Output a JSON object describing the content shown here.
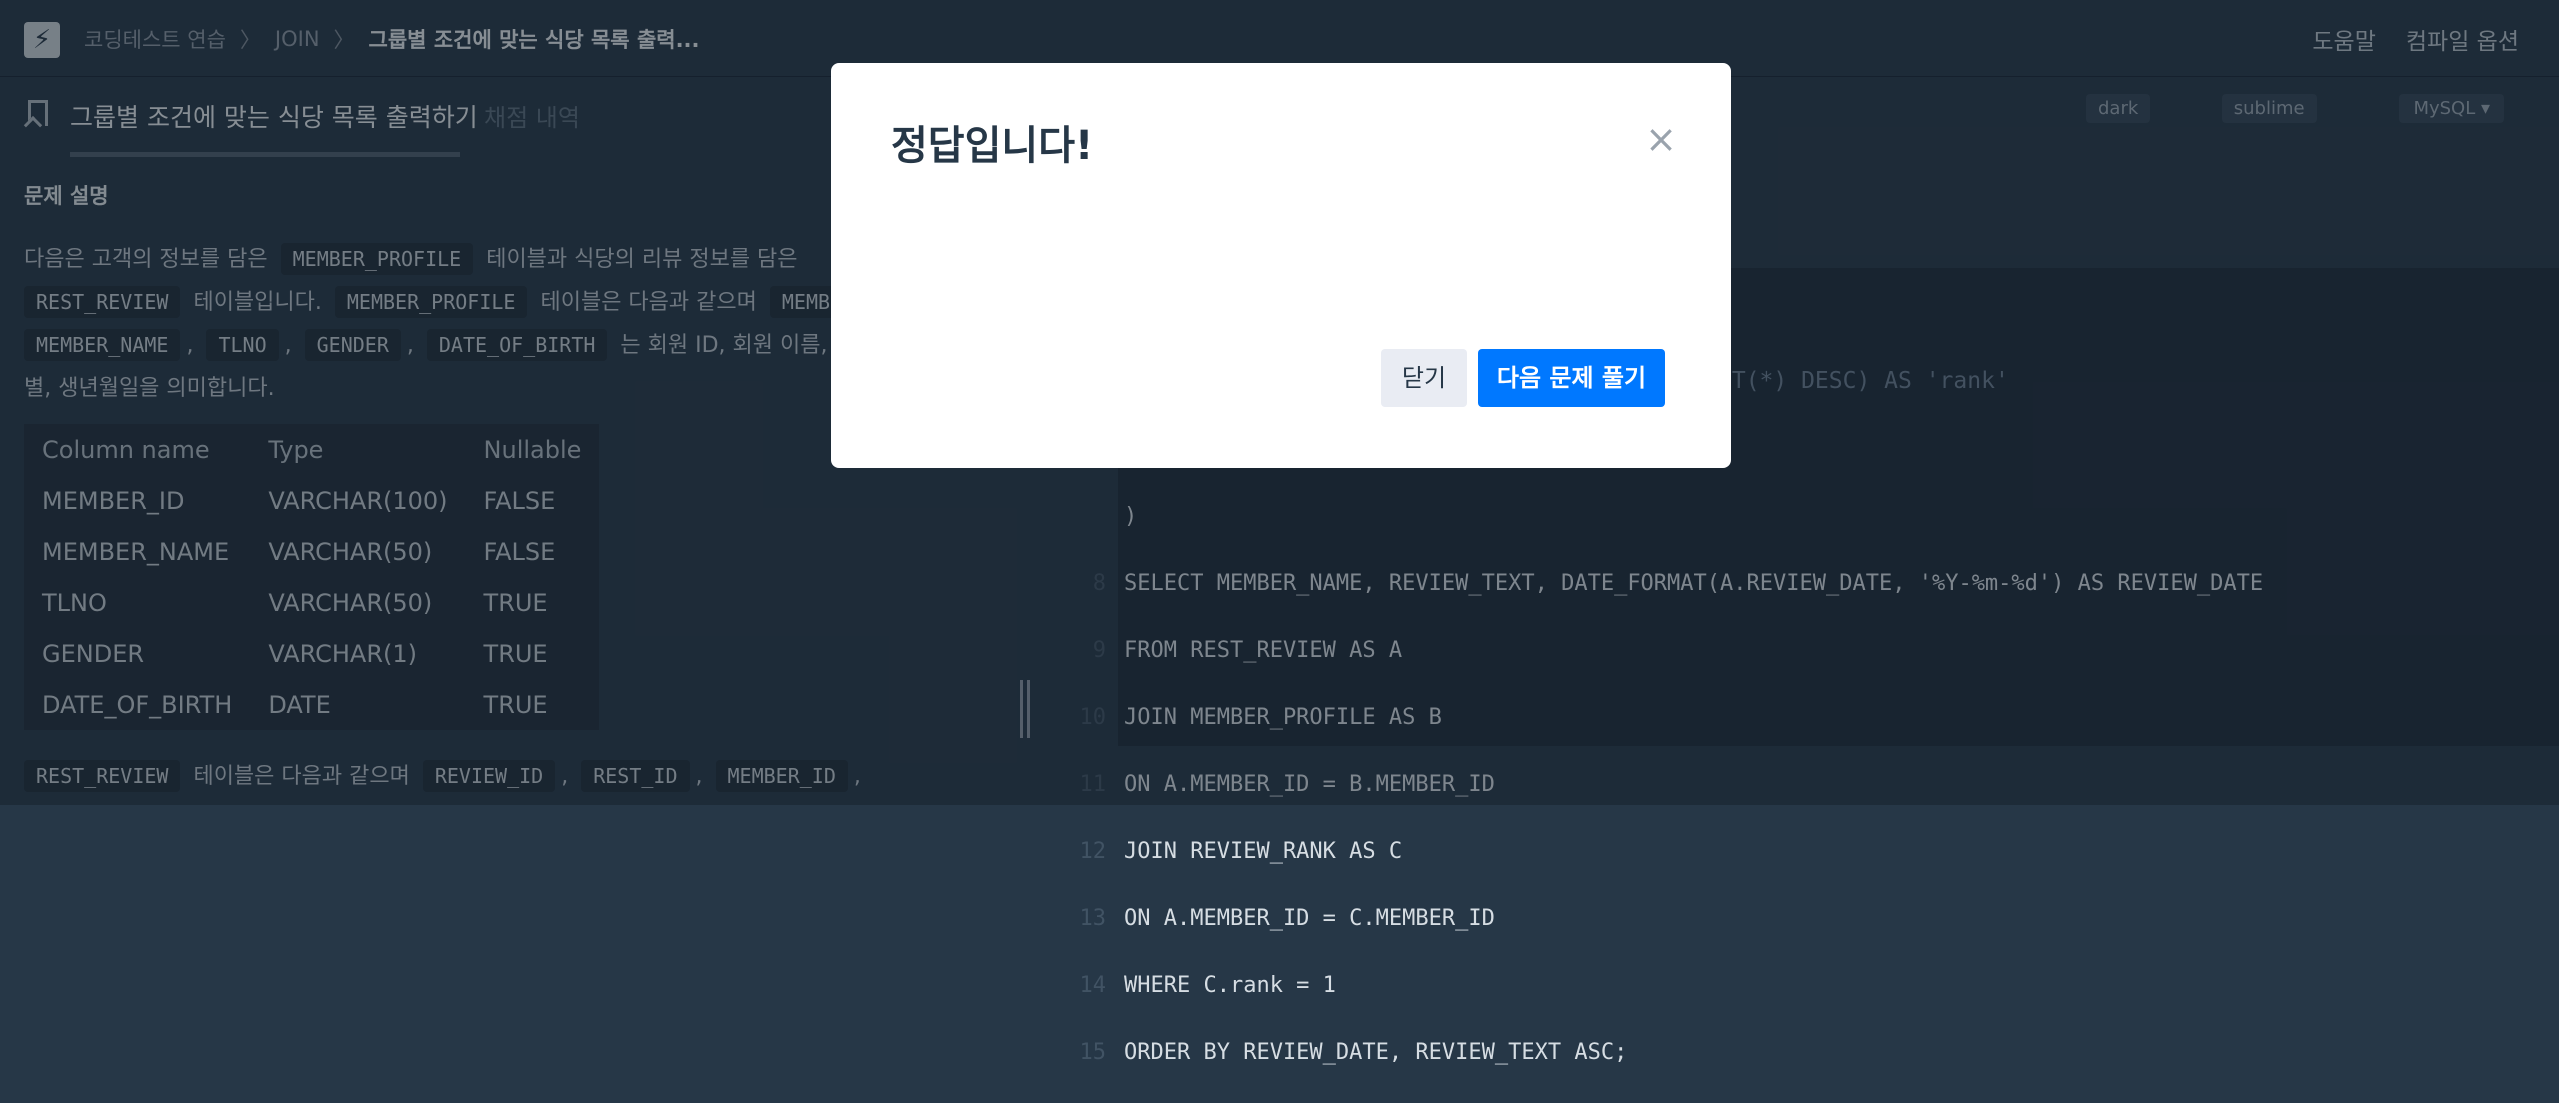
{
  "nav": {
    "breadcrumbs": [
      "코딩테스트 연습",
      "JOIN",
      "그룹별 조건에 맞는 식당 목록 출력..."
    ],
    "help": "도움말",
    "compile_options": "컴파일 옵션"
  },
  "tabs": {
    "problem": "그룹별 조건에 맞는 식당 목록 출력하기",
    "history": "채점 내역"
  },
  "problem": {
    "section_title": "문제 설명",
    "line1_text": "다음은 고객의 정보를 담은",
    "member_profile": "MEMBER_PROFILE",
    "line1_text2": "테이블과 식당의 리뷰 정보를 담은",
    "rest_review": "REST_REVIEW",
    "line2_text": "테이블입니다.",
    "line2_text2": "테이블은 다음과 같으며",
    "member_id_partial": "MEMB",
    "member_name": "MEMBER_NAME",
    "tlno": "TLNO",
    "gender": "GENDER",
    "date_of_birth": "DATE_OF_BIRTH",
    "line3_text": "는 회원 ID, 회원 이름, 회",
    "line4_text": "별, 생년월일을 의미합니다.",
    "line5_text": "테이블은 다음과 같으며",
    "review_id": "REVIEW_ID",
    "rest_id": "REST_ID",
    "member_id": "MEMBER_ID",
    "comma": ","
  },
  "column_table": {
    "headers": [
      "Column name",
      "Type",
      "Nullable"
    ],
    "rows": [
      [
        "MEMBER_ID",
        "VARCHAR(100)",
        "FALSE"
      ],
      [
        "MEMBER_NAME",
        "VARCHAR(50)",
        "FALSE"
      ],
      [
        "TLNO",
        "VARCHAR(50)",
        "TRUE"
      ],
      [
        "GENDER",
        "VARCHAR(1)",
        "TRUE"
      ],
      [
        "DATE_OF_BIRTH",
        "DATE",
        "TRUE"
      ]
    ]
  },
  "editor": {
    "theme_dark": "dark",
    "theme_sublime": "sublime",
    "language": "MySQL",
    "partial_line": "NT(*) DESC) AS 'rank'",
    "lines": [
      {
        "n": "",
        "code": ")"
      },
      {
        "n": "8",
        "code": "SELECT MEMBER_NAME, REVIEW_TEXT, DATE_FORMAT(A.REVIEW_DATE, '%Y-%m-%d') AS REVIEW_DATE"
      },
      {
        "n": "9",
        "code": "FROM REST_REVIEW AS A"
      },
      {
        "n": "10",
        "code": "JOIN MEMBER_PROFILE AS B"
      },
      {
        "n": "11",
        "code": "ON A.MEMBER_ID = B.MEMBER_ID"
      },
      {
        "n": "12",
        "code": "JOIN REVIEW_RANK AS C"
      },
      {
        "n": "13",
        "code": "ON A.MEMBER_ID = C.MEMBER_ID"
      },
      {
        "n": "14",
        "code": "WHERE C.rank = 1"
      },
      {
        "n": "15",
        "code": "ORDER BY REVIEW_DATE, REVIEW_TEXT ASC;"
      }
    ]
  },
  "modal": {
    "title": "정답입니다!",
    "close_icon": "×",
    "close_button": "닫기",
    "next_button": "다음 문제 풀기"
  },
  "colors": {
    "background": "#263747",
    "primary_button": "#0078ff",
    "modal_bg": "#ffffff"
  }
}
